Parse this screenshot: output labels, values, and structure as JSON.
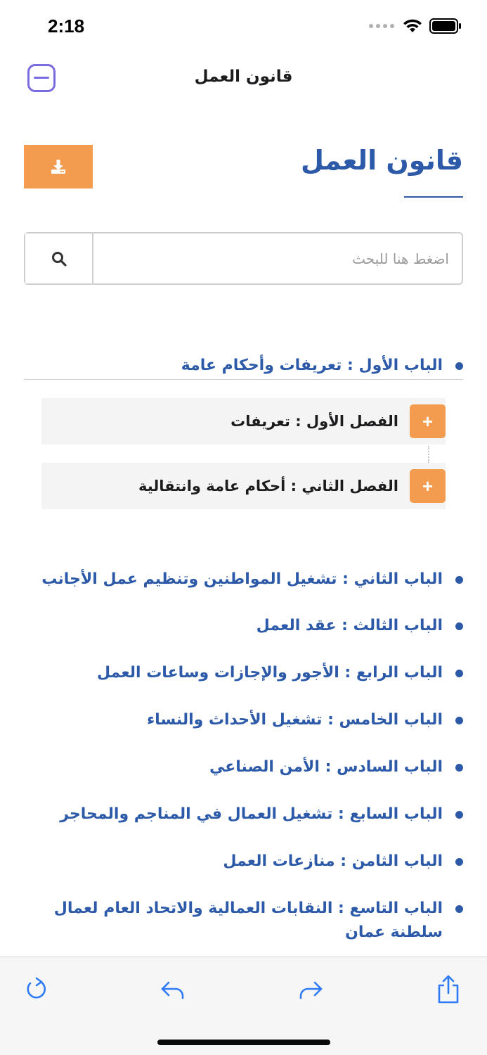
{
  "status_bar": {
    "time": "2:18"
  },
  "nav": {
    "title": "قانون العمل"
  },
  "page": {
    "title": "قانون العمل"
  },
  "search": {
    "placeholder": "اضغط هنا للبحث"
  },
  "chapters": [
    {
      "label": "الباب الأول : تعريفات وأحكام عامة",
      "expanded": true
    },
    {
      "label": "الباب الثاني : تشغيل المواطنين وتنظيم عمل الأجانب"
    },
    {
      "label": "الباب الثالث : عقد العمل"
    },
    {
      "label": "الباب الرابع : الأجور والإجازات وساعات العمل"
    },
    {
      "label": "الباب الخامس : تشغيل الأحداث والنساء"
    },
    {
      "label": "الباب السادس : الأمن الصناعي"
    },
    {
      "label": "الباب السابع : تشغيل العمال في المناجم والمحاجر"
    },
    {
      "label": "الباب الثامن : منازعات العمل"
    },
    {
      "label": "الباب التاسع : النقابات العمالية والاتحاد العام لعمال سلطنة عمان"
    }
  ],
  "sections": [
    {
      "label": "الفصل الأول : تعريفات",
      "expand_symbol": "+"
    },
    {
      "label": "الفصل الثاني : أحكام عامة وانتقالية",
      "expand_symbol": "+"
    }
  ],
  "icons": {
    "download": "download-icon",
    "search": "search-icon",
    "reload": "reload-icon",
    "back": "back-arrow-icon",
    "forward": "forward-arrow-icon",
    "share": "share-icon"
  },
  "colors": {
    "accent_blue": "#2c5aa8",
    "orange": "#f39c4f",
    "purple": "#7a6be0",
    "toolbar_icon": "#2f7bf6"
  }
}
